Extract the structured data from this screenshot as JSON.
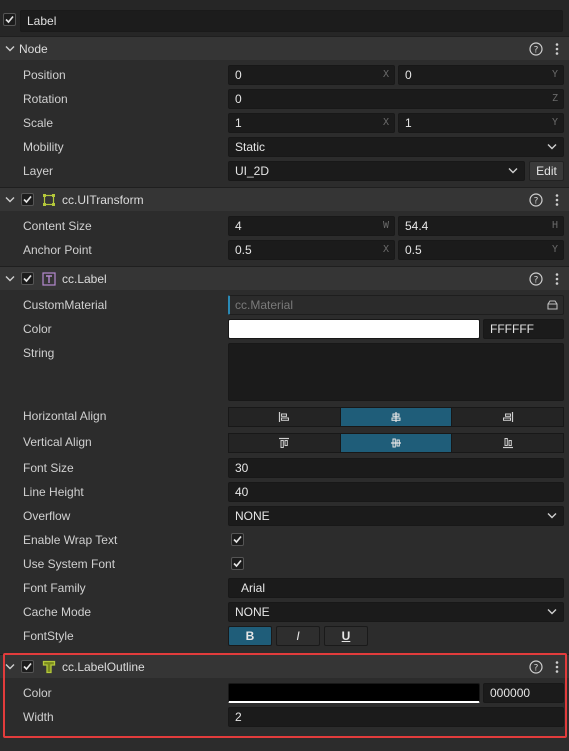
{
  "node_name": {
    "value": "Label",
    "enabled": true
  },
  "sections": {
    "node": {
      "title": "Node"
    },
    "ui_transform": {
      "title": "cc.UITransform"
    },
    "label": {
      "title": "cc.Label"
    },
    "label_outline": {
      "title": "cc.LabelOutline"
    }
  },
  "node": {
    "position": {
      "label": "Position",
      "x": "0",
      "y": "0",
      "x_suffix": "X",
      "y_suffix": "Y"
    },
    "rotation": {
      "label": "Rotation",
      "value": "0",
      "suffix": "Z"
    },
    "scale": {
      "label": "Scale",
      "x": "1",
      "y": "1",
      "x_suffix": "X",
      "y_suffix": "Y"
    },
    "mobility": {
      "label": "Mobility",
      "value": "Static"
    },
    "layer": {
      "label": "Layer",
      "value": "UI_2D",
      "edit_label": "Edit"
    }
  },
  "ui_transform": {
    "content_size": {
      "label": "Content Size",
      "w": "4",
      "h": "54.4",
      "w_suffix": "W",
      "h_suffix": "H"
    },
    "anchor_point": {
      "label": "Anchor Point",
      "x": "0.5",
      "y": "0.5",
      "x_suffix": "X",
      "y_suffix": "Y"
    }
  },
  "label": {
    "custom_material": {
      "label": "CustomMaterial",
      "placeholder": "cc.Material"
    },
    "color": {
      "label": "Color",
      "hex": "FFFFFF",
      "swatch": "#ffffff"
    },
    "string": {
      "label": "String",
      "value": ""
    },
    "horizontal_align": {
      "label": "Horizontal Align",
      "options": [
        "left",
        "center",
        "right"
      ],
      "selected": "center"
    },
    "vertical_align": {
      "label": "Vertical Align",
      "options": [
        "top",
        "center",
        "bottom"
      ],
      "selected": "center"
    },
    "font_size": {
      "label": "Font Size",
      "value": "30"
    },
    "line_height": {
      "label": "Line Height",
      "value": "40"
    },
    "overflow": {
      "label": "Overflow",
      "value": "NONE"
    },
    "enable_wrap_text": {
      "label": "Enable Wrap Text",
      "checked": true
    },
    "use_system_font": {
      "label": "Use System Font",
      "checked": true
    },
    "font_family": {
      "label": "Font Family",
      "value": "Arial"
    },
    "cache_mode": {
      "label": "Cache Mode",
      "value": "NONE"
    },
    "font_style": {
      "label": "FontStyle",
      "bold": "B",
      "italic": "I",
      "underline": "U"
    }
  },
  "label_outline": {
    "color": {
      "label": "Color",
      "hex": "000000",
      "swatch": "#000000"
    },
    "width": {
      "label": "Width",
      "value": "2"
    }
  },
  "colors": {
    "accent": "#1f5d79",
    "highlight_border": "#e23c3c",
    "background": "#2c2c2c",
    "field_bg": "#1b1b1b"
  }
}
